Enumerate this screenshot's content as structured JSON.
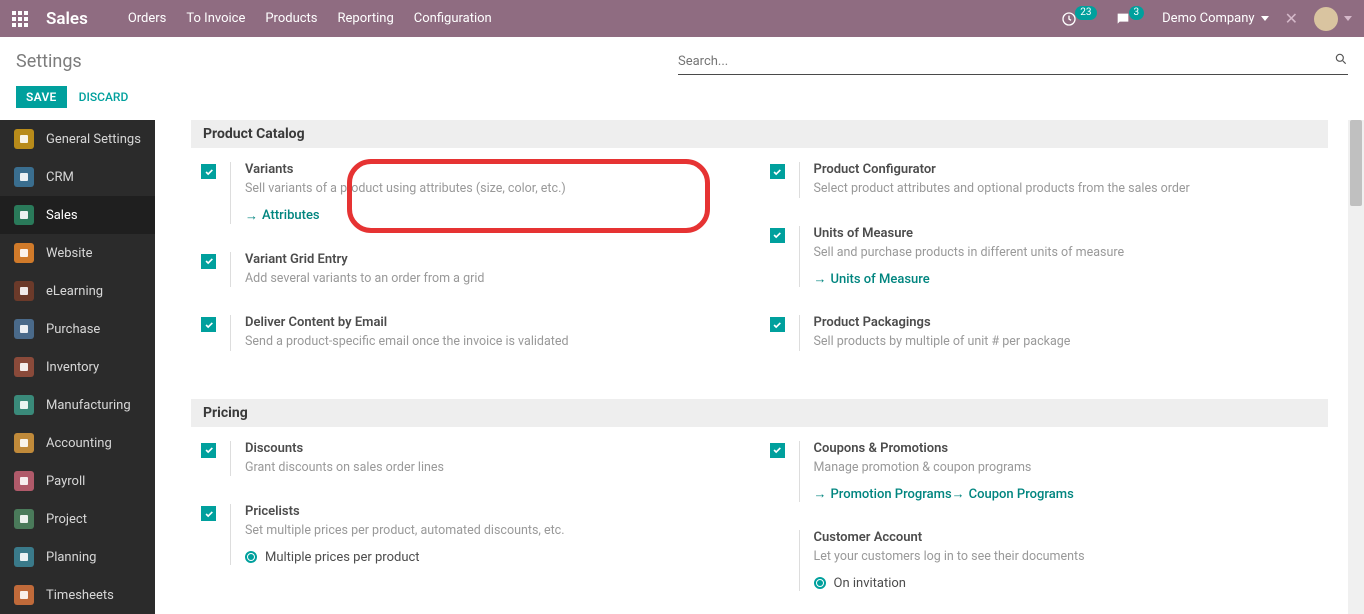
{
  "topnav": {
    "brand": "Sales",
    "menu": [
      "Orders",
      "To Invoice",
      "Products",
      "Reporting",
      "Configuration"
    ],
    "clock_badge": "23",
    "chat_badge": "3",
    "company": "Demo Company"
  },
  "page": {
    "title": "Settings",
    "search_placeholder": "Search...",
    "save_label": "SAVE",
    "discard_label": "DISCARD"
  },
  "sidebar": {
    "items": [
      {
        "label": "General Settings",
        "color": "#b88b1a"
      },
      {
        "label": "CRM",
        "color": "#3a6e8f"
      },
      {
        "label": "Sales",
        "color": "#2a7a5a",
        "active": true
      },
      {
        "label": "Website",
        "color": "#d07a2a"
      },
      {
        "label": "eLearning",
        "color": "#6b3a2a"
      },
      {
        "label": "Purchase",
        "color": "#4a6a8a"
      },
      {
        "label": "Inventory",
        "color": "#8a4a3a"
      },
      {
        "label": "Manufacturing",
        "color": "#3a8a7a"
      },
      {
        "label": "Accounting",
        "color": "#c08a3a"
      },
      {
        "label": "Payroll",
        "color": "#b05a6a"
      },
      {
        "label": "Project",
        "color": "#4a7a5a"
      },
      {
        "label": "Planning",
        "color": "#3a7a8a"
      },
      {
        "label": "Timesheets",
        "color": "#c06a3a"
      }
    ]
  },
  "sections": [
    {
      "title": "Product Catalog",
      "left": [
        {
          "title": "Variants",
          "desc": "Sell variants of a product using attributes (size, color, etc.)",
          "link": "Attributes",
          "checked": true
        },
        {
          "title": "Variant Grid Entry",
          "desc": "Add several variants to an order from a grid",
          "checked": true
        },
        {
          "title": "Deliver Content by Email",
          "desc": "Send a product-specific email once the invoice is validated",
          "checked": true
        }
      ],
      "right": [
        {
          "title": "Product Configurator",
          "desc": "Select product attributes and optional products from the sales order",
          "checked": true
        },
        {
          "title": "Units of Measure",
          "desc": "Sell and purchase products in different units of measure",
          "link": "Units of Measure",
          "checked": true
        },
        {
          "title": "Product Packagings",
          "desc": "Sell products by multiple of unit # per package",
          "checked": true
        }
      ]
    },
    {
      "title": "Pricing",
      "left": [
        {
          "title": "Discounts",
          "desc": "Grant discounts on sales order lines",
          "checked": true
        },
        {
          "title": "Pricelists",
          "desc": "Set multiple prices per product, automated discounts, etc.",
          "checked": true,
          "radio": "Multiple prices per product"
        }
      ],
      "right": [
        {
          "title": "Coupons & Promotions",
          "desc": "Manage promotion & coupon programs",
          "checked": true,
          "links": [
            "Promotion Programs",
            "Coupon Programs"
          ]
        },
        {
          "title": "Customer Account",
          "desc": "Let your customers log in to see their documents",
          "nocheck": true,
          "radio": "On invitation"
        }
      ]
    }
  ]
}
